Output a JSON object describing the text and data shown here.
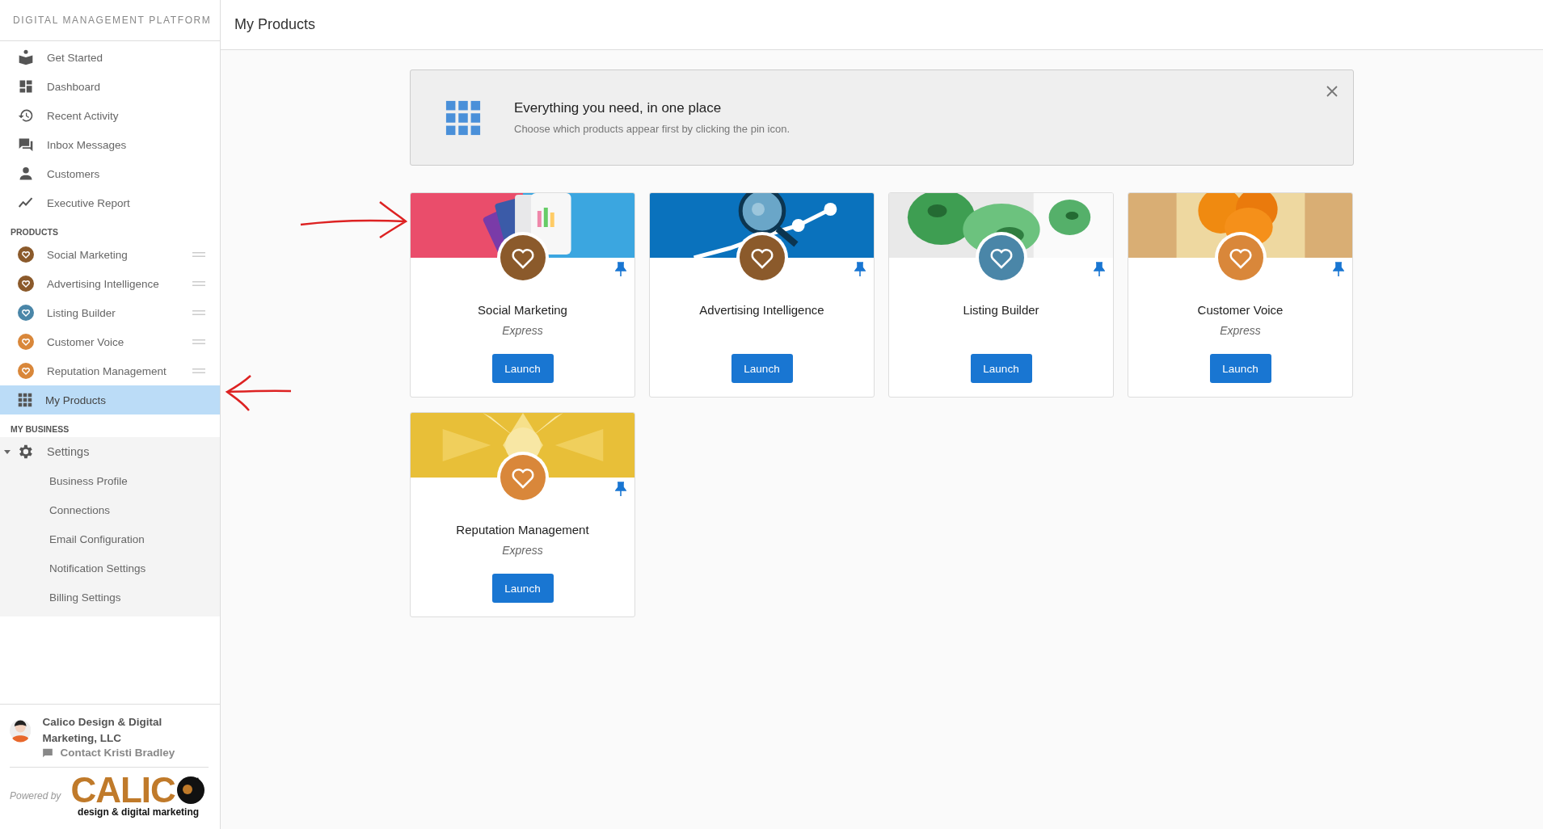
{
  "sidebar": {
    "title": "DIGITAL MANAGEMENT PLATFORM",
    "nav": [
      {
        "label": "Get Started",
        "selected": false
      },
      {
        "label": "Dashboard",
        "selected": false
      },
      {
        "label": "Recent Activity",
        "selected": false
      },
      {
        "label": "Inbox Messages",
        "selected": false
      },
      {
        "label": "Customers",
        "selected": false
      },
      {
        "label": "Executive Report",
        "selected": false
      }
    ],
    "products_heading": "PRODUCTS",
    "products": [
      {
        "label": "Social Marketing",
        "color": "#8b5a2b",
        "selected": false
      },
      {
        "label": "Advertising Intelligence",
        "color": "#8b5a2b",
        "selected": false
      },
      {
        "label": "Listing Builder",
        "color": "#4a86a8",
        "selected": false
      },
      {
        "label": "Customer Voice",
        "color": "#d9873a",
        "selected": false
      },
      {
        "label": "Reputation Management",
        "color": "#d9873a",
        "selected": false
      },
      {
        "label": "My Products",
        "selected": true
      }
    ],
    "business_heading": "MY BUSINESS",
    "settings": {
      "label": "Settings",
      "expanded": true,
      "children": [
        {
          "label": "Business Profile",
          "selected": false
        },
        {
          "label": "Connections",
          "selected": false
        },
        {
          "label": "Email Configuration",
          "selected": false
        },
        {
          "label": "Notification Settings",
          "selected": false
        },
        {
          "label": "Billing Settings",
          "selected": false
        }
      ]
    },
    "account": {
      "name": "Calico Design & Digital Marketing, LLC",
      "contact": "Contact Kristi Bradley"
    },
    "powered_by": "Powered by",
    "logo": {
      "word": "CALIC",
      "tagline": "design & digital marketing"
    }
  },
  "header": {
    "title": "My Products"
  },
  "banner": {
    "title": "Everything you need, in one place",
    "subtitle": "Choose which products appear first by clicking the pin icon."
  },
  "cards": [
    {
      "name": "Social Marketing",
      "edition": "Express",
      "color": "#8b5a2b",
      "pinned": true,
      "button": "Launch"
    },
    {
      "name": "Advertising Intelligence",
      "color": "#8b5a2b",
      "pinned": true,
      "button": "Launch"
    },
    {
      "name": "Listing Builder",
      "color": "#4a86a8",
      "pinned": true,
      "button": "Launch"
    },
    {
      "name": "Customer Voice",
      "edition": "Express",
      "color": "#d9873a",
      "pinned": true,
      "button": "Launch"
    },
    {
      "name": "Reputation Management",
      "edition": "Express",
      "color": "#d9873a",
      "pinned": true,
      "button": "Launch"
    }
  ]
}
